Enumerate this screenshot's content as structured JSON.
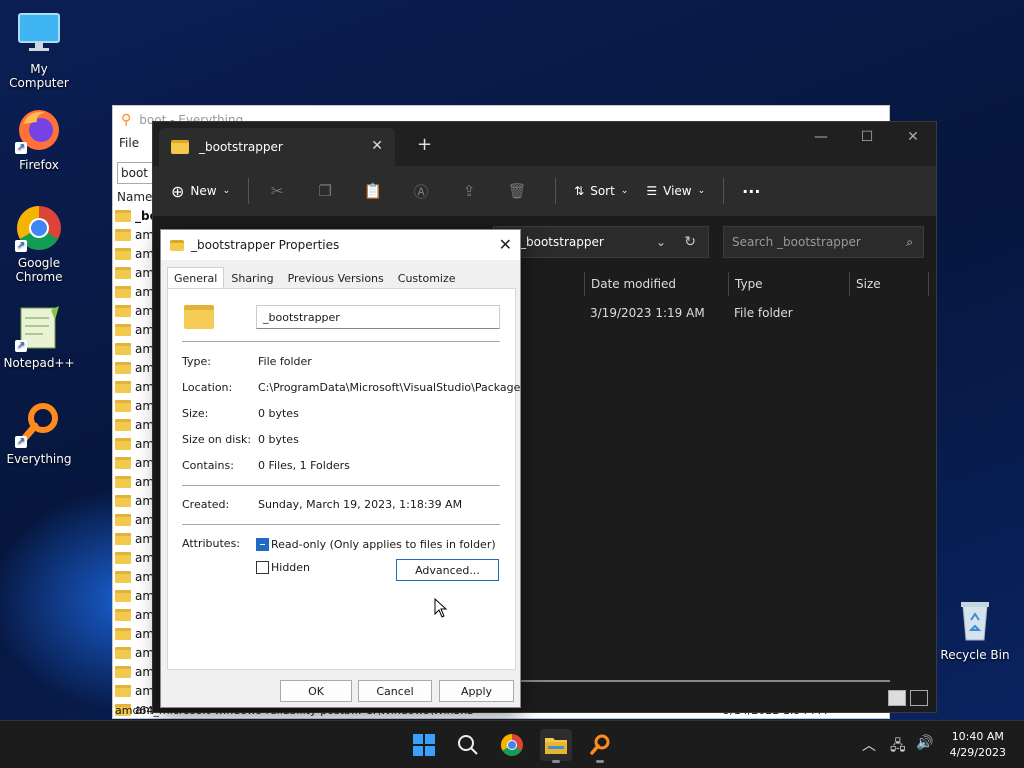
{
  "desktop": {
    "icons": [
      {
        "label": "My Computer"
      },
      {
        "label": "Firefox"
      },
      {
        "label": "Google Chrome"
      },
      {
        "label": "Notepad++"
      },
      {
        "label": "Everything"
      },
      {
        "label": "Recycle Bin"
      }
    ]
  },
  "everything_window": {
    "title": "boot - Everything",
    "menu_file": "File",
    "search_value": "boot",
    "column_name": "Name",
    "first_row": "_bo",
    "row_prefix": "am",
    "row_count": 26,
    "bottom_row_text": "amd64_microsoft-windows-reliability-postb... C:\\Windows\\WinSxS",
    "bottom_row_date": "5/14/2022 1:54 PM"
  },
  "explorer": {
    "tab_title": "_bootstrapper",
    "toolbar": {
      "new_label": "New",
      "sort_label": "Sort",
      "view_label": "View",
      "more_label": "···"
    },
    "address_text": "_bootstrapper",
    "search_placeholder": "Search _bootstrapper",
    "columns": {
      "date": "Date modified",
      "type": "Type",
      "size": "Size"
    },
    "row": {
      "date": "3/19/2023 1:19 AM",
      "type": "File folder"
    }
  },
  "properties": {
    "title": "_bootstrapper Properties",
    "tabs": [
      "General",
      "Sharing",
      "Previous Versions",
      "Customize"
    ],
    "name_value": "_bootstrapper",
    "type_label": "Type:",
    "type_value": "File folder",
    "location_label": "Location:",
    "location_value": "C:\\ProgramData\\Microsoft\\VisualStudio\\Packages",
    "size_label": "Size:",
    "size_value": "0 bytes",
    "size_on_disk_label": "Size on disk:",
    "size_on_disk_value": "0 bytes",
    "contains_label": "Contains:",
    "contains_value": "0 Files, 1 Folders",
    "created_label": "Created:",
    "created_value": "Sunday, March 19, 2023, 1:18:39 AM",
    "attributes_label": "Attributes:",
    "readonly_label": "Read-only (Only applies to files in folder)",
    "hidden_label": "Hidden",
    "advanced_label": "Advanced...",
    "ok_label": "OK",
    "cancel_label": "Cancel",
    "apply_label": "Apply"
  },
  "taskbar": {
    "time": "10:40 AM",
    "date": "4/29/2023"
  }
}
